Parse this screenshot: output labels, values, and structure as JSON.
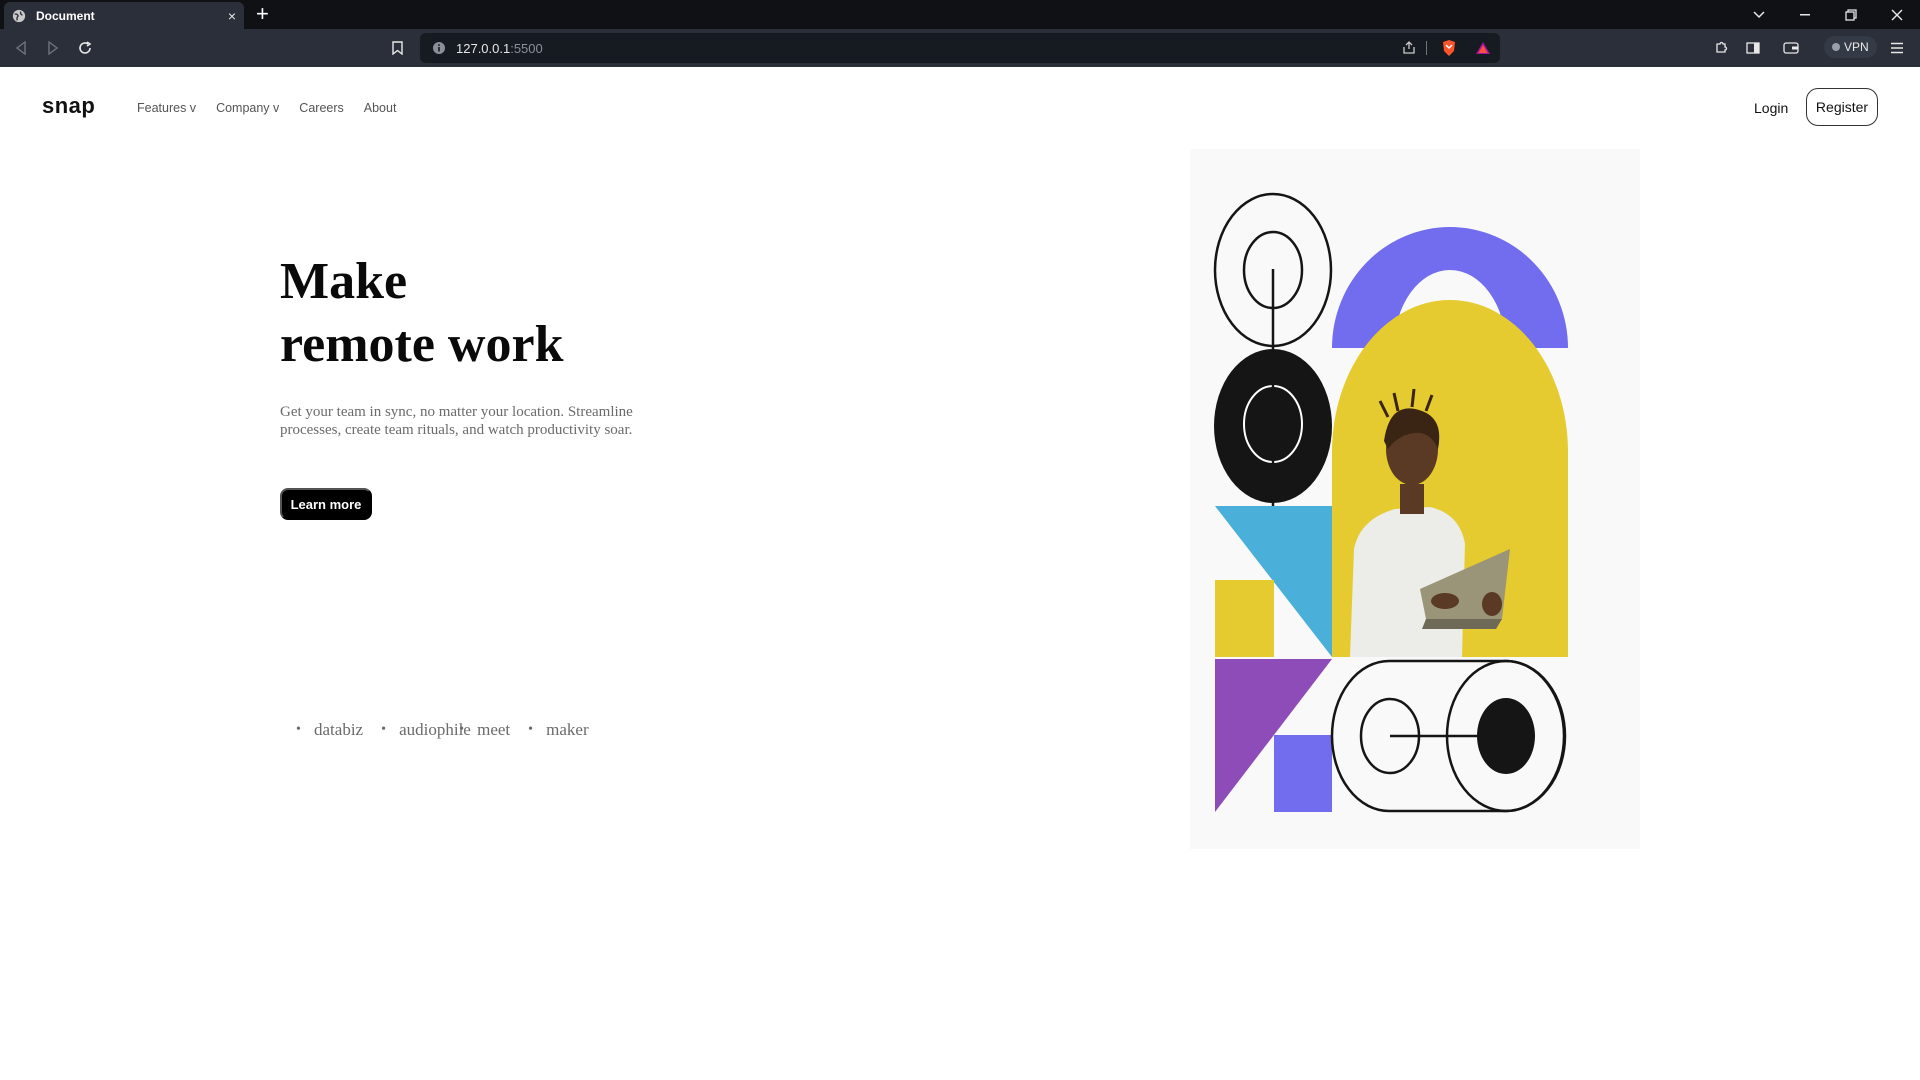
{
  "browser": {
    "tab_title": "Document",
    "tab_close": "×",
    "new_tab": "+",
    "url_host": "127.0.0.1",
    "url_port": ":5500",
    "vpn_label": "VPN"
  },
  "nav": {
    "logo": "snap",
    "items": [
      "Features v",
      "Company v",
      "Careers",
      "About"
    ],
    "login": "Login",
    "register": "Register"
  },
  "hero": {
    "title_line1": "Make",
    "title_line2": "remote work",
    "description": "Get your team in sync, no matter your location. Streamline processes, create team rituals, and watch productivity soar.",
    "cta": "Learn more"
  },
  "clients": [
    "databiz",
    "audiophile",
    "meet",
    "maker"
  ],
  "colors": {
    "purple_arch": "#726CEE",
    "yellow": "#E5CB2F",
    "cyan": "#4AAFD9",
    "violet": "#8E4CB8",
    "dark": "#151515"
  }
}
